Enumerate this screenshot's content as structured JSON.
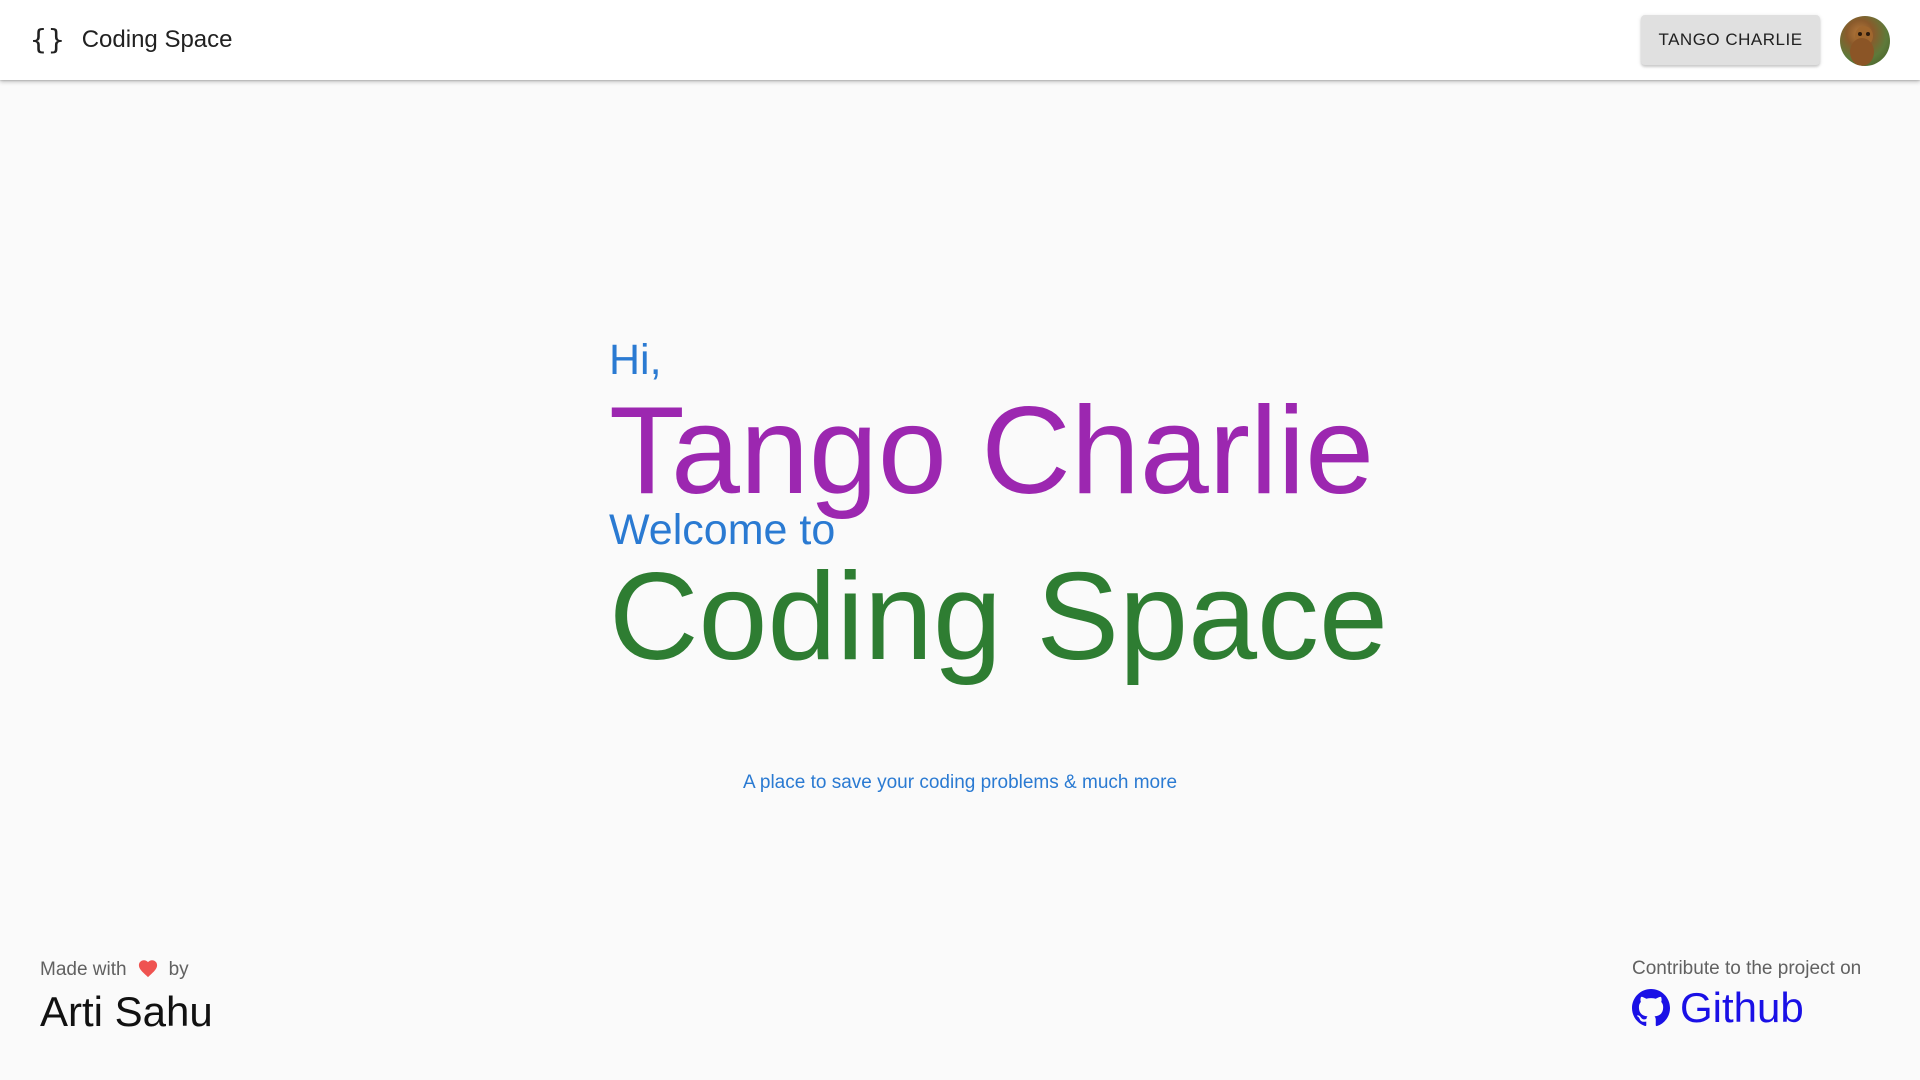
{
  "appbar": {
    "brand_icon": "{}",
    "title": "Coding Space",
    "user_button_label": "TANGO CHARLIE",
    "avatar_icon": "user-avatar-photo"
  },
  "hero": {
    "greeting": "Hi,",
    "user_name": "Tango Charlie",
    "welcome": "Welcome to",
    "app_name": "Coding Space",
    "tagline": "A place to save your coding problems & much more"
  },
  "footer": {
    "made_with": "Made with",
    "heart_icon": "heart-icon",
    "by": "by",
    "author": "Arti Sahu",
    "contribute_text": "Contribute to the project on",
    "github_label": "Github",
    "github_icon": "github-icon"
  },
  "colors": {
    "accent_blue": "#2a7ad2",
    "name_purple": "#9c27b0",
    "app_green": "#2e7d32",
    "link_blue": "#1a10e6",
    "heart_red": "#ef5350"
  }
}
